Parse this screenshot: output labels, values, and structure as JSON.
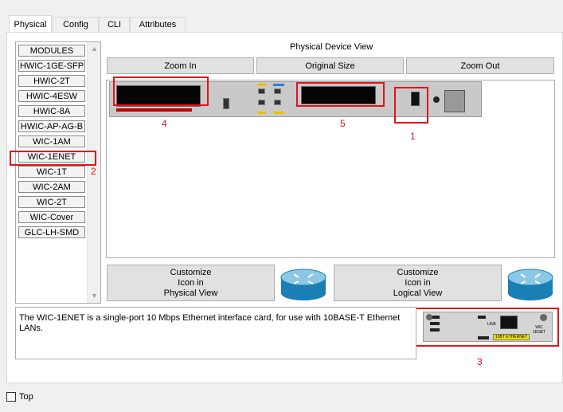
{
  "tabs": [
    {
      "label": "Physical"
    },
    {
      "label": "Config"
    },
    {
      "label": "CLI"
    },
    {
      "label": "Attributes"
    }
  ],
  "modules": [
    "MODULES",
    "HWIC-1GE-SFP",
    "HWIC-2T",
    "HWIC-4ESW",
    "HWIC-8A",
    "HWIC-AP-AG-B",
    "WIC-1AM",
    "WIC-1ENET",
    "WIC-1T",
    "WIC-2AM",
    "WIC-2T",
    "WIC-Cover",
    "GLC-LH-SMD"
  ],
  "view": {
    "title": "Physical Device View",
    "zoom_in": "Zoom In",
    "original_size": "Original Size",
    "zoom_out": "Zoom Out"
  },
  "customize": {
    "physical_line1": "Customize",
    "physical_line2": "Icon in",
    "physical_line3": "Physical View",
    "logical_line1": "Customize",
    "logical_line2": "Icon in",
    "logical_line3": "Logical View"
  },
  "description": "The WIC-1ENET is a single-port 10 Mbps Ethernet interface card, for use with 10BASE-T Ethernet LANs.",
  "module_image": {
    "link_label": "LINK",
    "port_label": "10BT ETHERNET",
    "card_label_line1": "WIC",
    "card_label_line2": "1ENET"
  },
  "annotations": {
    "n1": "1",
    "n2": "2",
    "n3": "3",
    "n4": "4",
    "n5": "5",
    "color": "#e0141b"
  },
  "footer": {
    "top_label": "Top",
    "top_checked": false
  }
}
